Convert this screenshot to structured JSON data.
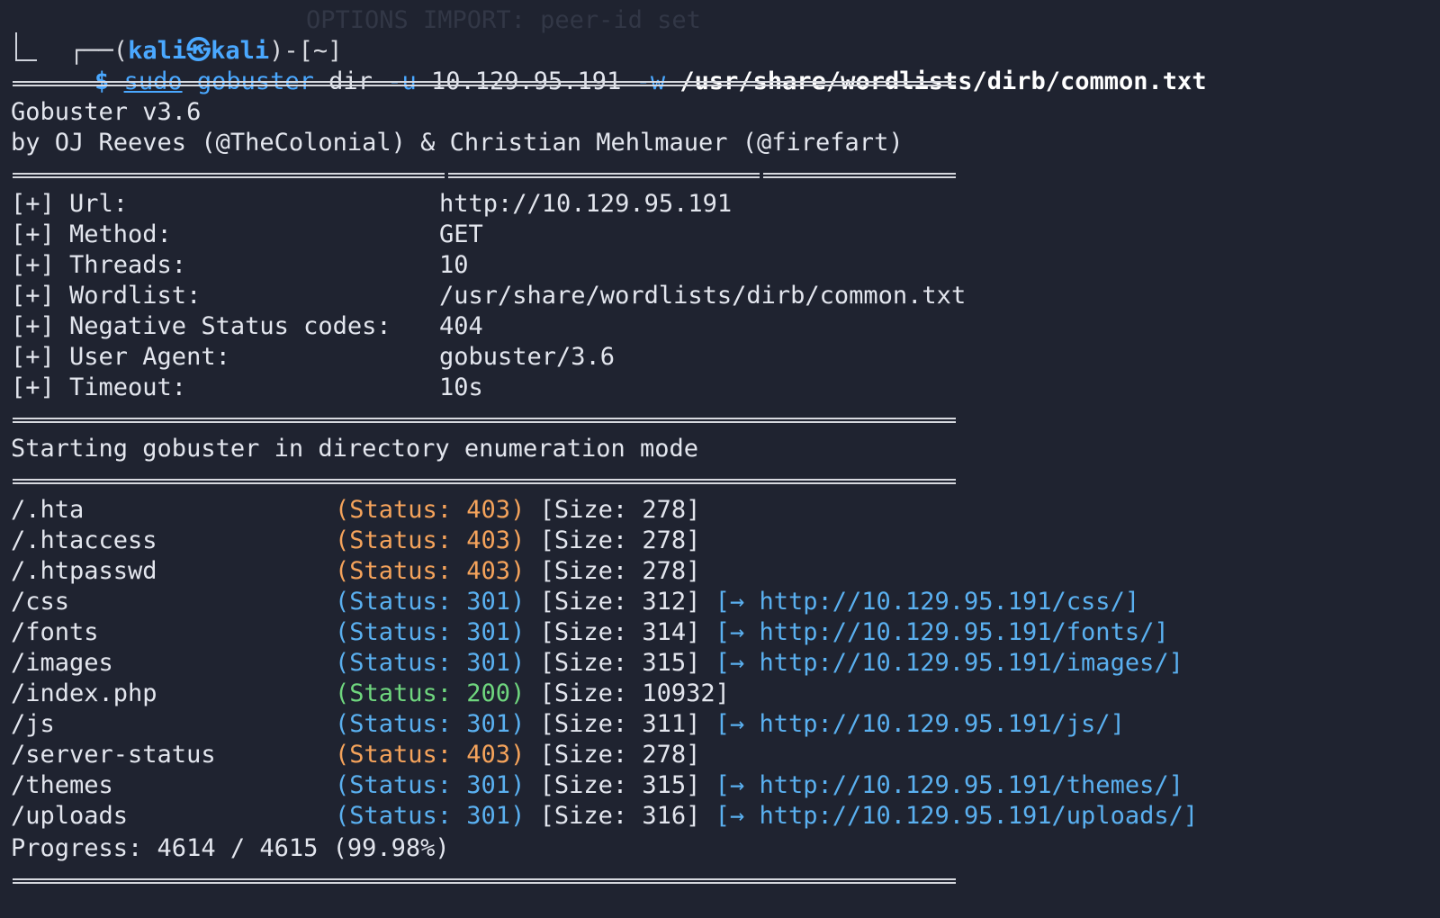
{
  "prompt": {
    "open": "┌──(",
    "user": "kali",
    "at": "㉿",
    "host": "kali",
    "mid": ")-[",
    "dir": "~",
    "close": "]",
    "symbol": "└─$"
  },
  "command": {
    "sudo": "sudo",
    "program": "gobuster",
    "sub": "dir",
    "flag_u": "-u",
    "target": "10.129.95.191",
    "flag_w": "-w",
    "wordlist": "/usr/share/wordlists/dirb/common.txt"
  },
  "banner": {
    "title": "Gobuster v3.6",
    "authors": "by OJ Reeves (@TheColonial) & Christian Mehlmauer (@firefart)"
  },
  "config": [
    {
      "key": "[+] Url:",
      "value": "http://10.129.95.191"
    },
    {
      "key": "[+] Method:",
      "value": "GET"
    },
    {
      "key": "[+] Threads:",
      "value": "10"
    },
    {
      "key": "[+] Wordlist:",
      "value": "/usr/share/wordlists/dirb/common.txt"
    },
    {
      "key": "[+] Negative Status codes:",
      "value": "404"
    },
    {
      "key": "[+] User Agent:",
      "value": "gobuster/3.6"
    },
    {
      "key": "[+] Timeout:",
      "value": "10s"
    }
  ],
  "mode_line": "Starting gobuster in directory enumeration mode",
  "results": [
    {
      "path": "/.hta",
      "status": "(Status: 403)",
      "code": "403",
      "size": "[Size: 278]",
      "redirect": ""
    },
    {
      "path": "/.htaccess",
      "status": "(Status: 403)",
      "code": "403",
      "size": "[Size: 278]",
      "redirect": ""
    },
    {
      "path": "/.htpasswd",
      "status": "(Status: 403)",
      "code": "403",
      "size": "[Size: 278]",
      "redirect": ""
    },
    {
      "path": "/css",
      "status": "(Status: 301)",
      "code": "301",
      "size": "[Size: 312]",
      "redirect": "[→ http://10.129.95.191/css/]"
    },
    {
      "path": "/fonts",
      "status": "(Status: 301)",
      "code": "301",
      "size": "[Size: 314]",
      "redirect": "[→ http://10.129.95.191/fonts/]"
    },
    {
      "path": "/images",
      "status": "(Status: 301)",
      "code": "301",
      "size": "[Size: 315]",
      "redirect": "[→ http://10.129.95.191/images/]"
    },
    {
      "path": "/index.php",
      "status": "(Status: 200)",
      "code": "200",
      "size": "[Size: 10932]",
      "redirect": ""
    },
    {
      "path": "/js",
      "status": "(Status: 301)",
      "code": "301",
      "size": "[Size: 311]",
      "redirect": "[→ http://10.129.95.191/js/]"
    },
    {
      "path": "/server-status",
      "status": "(Status: 403)",
      "code": "403",
      "size": "[Size: 278]",
      "redirect": ""
    },
    {
      "path": "/themes",
      "status": "(Status: 301)",
      "code": "301",
      "size": "[Size: 315]",
      "redirect": "[→ http://10.129.95.191/themes/]"
    },
    {
      "path": "/uploads",
      "status": "(Status: 301)",
      "code": "301",
      "size": "[Size: 316]",
      "redirect": "[→ http://10.129.95.191/uploads/]"
    }
  ],
  "progress": "Progress: 4614 / 4615 (99.98%)",
  "colors": {
    "background": "#1f2330",
    "prompt_blue": "#4aa8ff",
    "status_403": "#f5a35b",
    "status_301": "#5ab0f0",
    "status_200": "#6fd67e"
  }
}
